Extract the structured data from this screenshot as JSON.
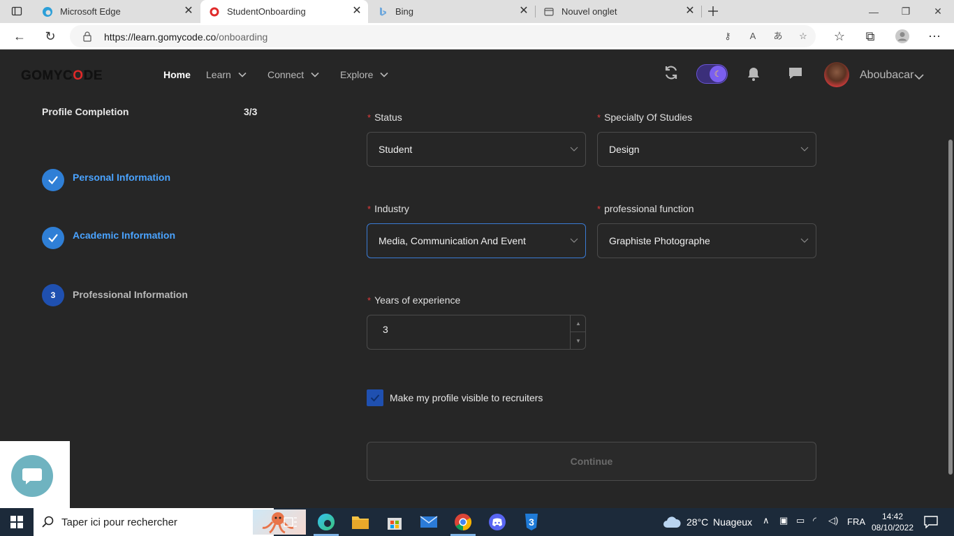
{
  "browser": {
    "tabs": [
      {
        "title": "Microsoft Edge",
        "icon": "edge-icon"
      },
      {
        "title": "StudentOnboarding",
        "icon": "gomycode-icon",
        "active": true
      },
      {
        "title": "Bing",
        "icon": "bing-icon"
      },
      {
        "title": "Nouvel onglet",
        "icon": "new-tab-icon"
      }
    ],
    "url_domain": "https://learn.gomycode.co",
    "url_path": "/onboarding"
  },
  "header": {
    "logo": "GOMYC",
    "logo_o": "O",
    "logo_rest": "DE",
    "nav": [
      {
        "label": "Home",
        "active": true
      },
      {
        "label": "Learn"
      },
      {
        "label": "Connect"
      },
      {
        "label": "Explore"
      }
    ],
    "username": "Aboubacar"
  },
  "progress": {
    "title": "Profile Completion",
    "count": "3/3",
    "steps": [
      {
        "label": "Personal Information",
        "status": "done"
      },
      {
        "label": "Academic Information",
        "status": "done"
      },
      {
        "label": "Professional Information",
        "status": "current",
        "number": "3"
      }
    ]
  },
  "form": {
    "required_mark": "*",
    "status": {
      "label": "Status",
      "value": "Student"
    },
    "specialty": {
      "label": "Specialty Of Studies",
      "value": "Design"
    },
    "industry": {
      "label": "Industry",
      "value": "Media, Communication And Event"
    },
    "function": {
      "label": "professional function",
      "value": "Graphiste Photographe"
    },
    "experience": {
      "label": "Years of experience",
      "value": "3"
    },
    "visible_checkbox": {
      "label": "Make my profile visible to recruiters",
      "checked": true
    },
    "continue_label": "Continue"
  },
  "taskbar": {
    "search_placeholder": "Taper ici pour rechercher",
    "weather_temp": "28°C",
    "weather_desc": "Nuageux",
    "language": "FRA",
    "time": "14:42",
    "date": "08/10/2022"
  },
  "colors": {
    "accent_blue": "#2f7fd6",
    "done_text": "#4aa3ff",
    "required": "#e23b3b",
    "background": "#262626"
  }
}
